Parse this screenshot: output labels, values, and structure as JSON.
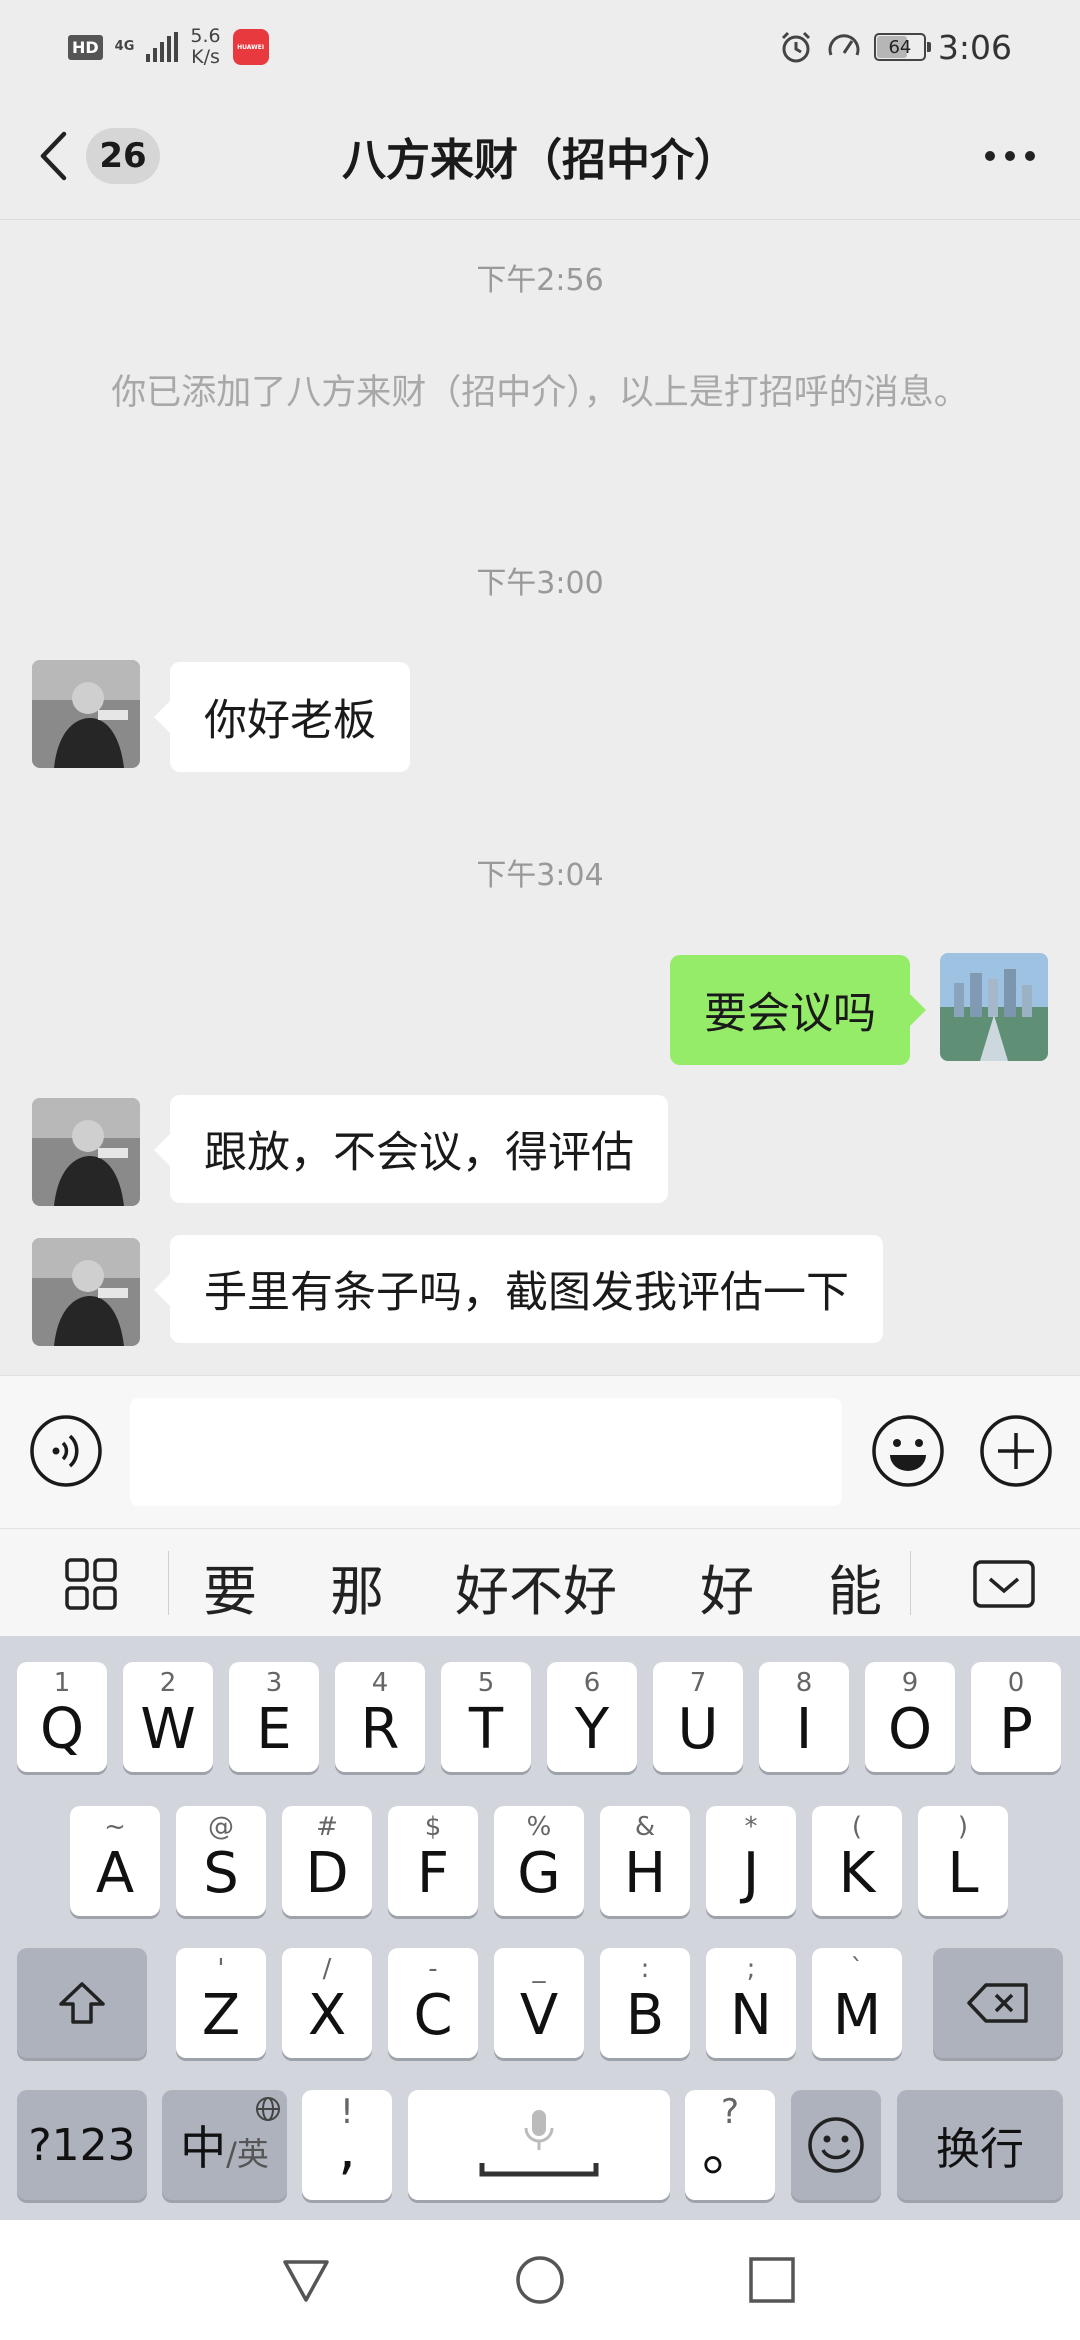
{
  "status_bar": {
    "hd": "HD",
    "network": "4G",
    "speed_value": "5.6",
    "speed_unit": "K/s",
    "app_badge": "HUAWEI",
    "battery": "64",
    "time": "3:06",
    "icons": [
      "alarm-icon",
      "speedometer-icon",
      "battery-icon"
    ]
  },
  "nav": {
    "unread_count": "26",
    "title": "八方来财（招中介）"
  },
  "chat": {
    "timestamps": [
      "下午2:56",
      "下午3:00",
      "下午3:04"
    ],
    "system_message": "你已添加了八方来财（招中介），以上是打招呼的消息。",
    "messages": [
      {
        "from": "contact",
        "text": "你好老板"
      },
      {
        "from": "me",
        "text": "要会议吗"
      },
      {
        "from": "contact",
        "text": "跟放，不会议，得评估"
      },
      {
        "from": "contact",
        "text": "手里有条子吗，截图发我评估一下"
      }
    ]
  },
  "input_bar": {
    "value": "",
    "icons": [
      "voice-icon",
      "emoji-icon",
      "plus-icon"
    ]
  },
  "suggestions": [
    "要",
    "那",
    "好不好",
    "好",
    "能"
  ],
  "keyboard": {
    "row1": [
      {
        "sub": "1",
        "main": "Q"
      },
      {
        "sub": "2",
        "main": "W"
      },
      {
        "sub": "3",
        "main": "E"
      },
      {
        "sub": "4",
        "main": "R"
      },
      {
        "sub": "5",
        "main": "T"
      },
      {
        "sub": "6",
        "main": "Y"
      },
      {
        "sub": "7",
        "main": "U"
      },
      {
        "sub": "8",
        "main": "I"
      },
      {
        "sub": "9",
        "main": "O"
      },
      {
        "sub": "0",
        "main": "P"
      }
    ],
    "row2": [
      {
        "sub": "~",
        "main": "A"
      },
      {
        "sub": "@",
        "main": "S"
      },
      {
        "sub": "#",
        "main": "D"
      },
      {
        "sub": "$",
        "main": "F"
      },
      {
        "sub": "%",
        "main": "G"
      },
      {
        "sub": "&",
        "main": "H"
      },
      {
        "sub": "*",
        "main": "J"
      },
      {
        "sub": "(",
        "main": "K"
      },
      {
        "sub": ")",
        "main": "L"
      }
    ],
    "row3": [
      {
        "sub": "'",
        "main": "Z"
      },
      {
        "sub": "/",
        "main": "X"
      },
      {
        "sub": "-",
        "main": "C"
      },
      {
        "sub": "_",
        "main": "V"
      },
      {
        "sub": ":",
        "main": "B"
      },
      {
        "sub": ";",
        "main": "N"
      },
      {
        "sub": "`",
        "main": "M"
      }
    ],
    "num_key": "?123",
    "lang_main": "中",
    "lang_sub": "/英",
    "comma_sub": "!",
    "comma_main": ",",
    "period_sub": "?",
    "period_main": "。",
    "enter": "换行"
  }
}
